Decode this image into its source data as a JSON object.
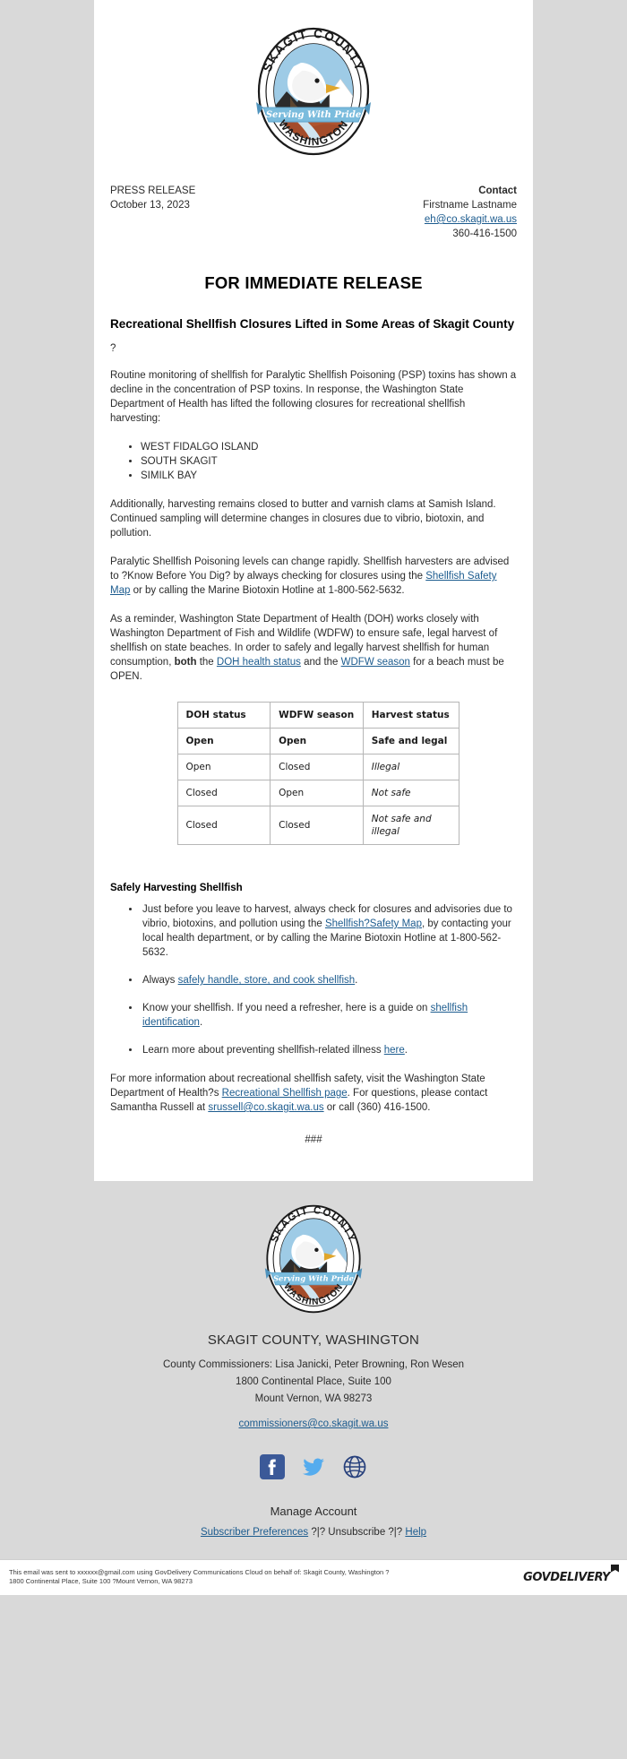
{
  "colors": {
    "link": "#1d5c8f",
    "page_bg": "#d9d9d9",
    "facebook": "#3b5998",
    "twitter": "#55acee",
    "globe": "#27407c"
  },
  "logo": {
    "alt": "Skagit County Washington seal",
    "top_text": "SKAGIT COUNTY",
    "bottom_text": "WASHINGTON",
    "ribbon_text": "Serving With Pride"
  },
  "header": {
    "kicker": "PRESS RELEASE",
    "date": "October 13, 2023",
    "contact_label": "Contact",
    "contact_name": "Firstname Lastname",
    "contact_email": "eh@co.skagit.wa.us",
    "contact_phone": "360-416-1500"
  },
  "release": {
    "headline": "FOR IMMEDIATE RELEASE",
    "subject": "Recreational Shellfish Closures Lifted in Some Areas of Skagit County",
    "stray_char": "?",
    "para_1": "Routine monitoring of shellfish for Paralytic Shellfish Poisoning (PSP) toxins has shown a decline in the concentration of PSP toxins. In response, the Washington State Department of Health has lifted the following closures for recreational shellfish harvesting:",
    "closures": [
      "WEST FIDALGO ISLAND",
      "SOUTH SKAGIT",
      "SIMILK BAY"
    ],
    "para_2": "Additionally, harvesting remains closed to butter and varnish clams at Samish Island. Continued sampling will determine changes in closures due to vibrio, biotoxin, and pollution.",
    "para_3_a": "Paralytic Shellfish Poisoning levels can change rapidly. Shellfish harvesters are advised to ?Know Before You Dig? by always checking for closures using the ",
    "para_3_link": "Shellfish Safety Map",
    "para_3_b": " or by calling the Marine Biotoxin Hotline at 1-800-562-5632.",
    "para_4_a": "As a reminder, Washington State Department of Health (DOH) works closely with Washington Department of Fish and Wildlife (WDFW) to ensure safe, legal harvest of shellfish on state beaches. In order to safely and legally harvest shellfish for human consumption, ",
    "para_4_bold": "both",
    "para_4_b": " the ",
    "para_4_link1": "DOH health status",
    "para_4_c": " and the ",
    "para_4_link2": "WDFW season",
    "para_4_d": " for a beach must be OPEN."
  },
  "status_table": {
    "headers": [
      "DOH status",
      "WDFW season",
      "Harvest status"
    ],
    "rows": [
      {
        "doh": "Open",
        "wdfw": "Open",
        "harvest": "Safe and legal",
        "bold": true,
        "italic": false
      },
      {
        "doh": "Open",
        "wdfw": "Closed",
        "harvest": "Illegal",
        "bold": false,
        "italic": true
      },
      {
        "doh": "Closed",
        "wdfw": "Open",
        "harvest": "Not safe",
        "bold": false,
        "italic": true
      },
      {
        "doh": "Closed",
        "wdfw": "Closed",
        "harvest": "Not safe and illegal",
        "bold": false,
        "italic": true
      }
    ]
  },
  "safely": {
    "heading": "Safely Harvesting Shellfish",
    "b1_a": "Just before you leave to harvest, always check for closures and advisories due to vibrio, biotoxins, and pollution using the ",
    "b1_link": "Shellfish?Safety Map",
    "b1_b": ", by contacting your local health department, or by calling the Marine Biotoxin Hotline at 1-800-562-5632.",
    "b2_a": "Always ",
    "b2_link": "safely handle, store, and cook shellfish",
    "b2_b": ".",
    "b3_a": "Know your shellfish. If you need a refresher, here is a guide on ",
    "b3_link": "shellfish identification",
    "b3_b": ".",
    "b4_a": "Learn more about preventing shellfish-related illness ",
    "b4_link": "here",
    "b4_b": "."
  },
  "closing": {
    "a": "For more information about recreational shellfish safety, visit the Washington State Department of Health?s ",
    "link1": "Recreational Shellfish page",
    "b": ". For questions, please contact Samantha Russell at ",
    "link2": "srussell@co.skagit.wa.us",
    "c": " or call (360) 416-1500.",
    "end_mark": "###"
  },
  "footer": {
    "org": "SKAGIT COUNTY, WASHINGTON",
    "commissioners": "County Commissioners: Lisa Janicki, Peter Browning, Ron Wesen",
    "address_1": "1800 Continental Place, Suite 100",
    "address_2": "Mount Vernon, WA 98273",
    "email": "commissioners@co.skagit.wa.us",
    "socials": [
      {
        "name": "facebook-icon",
        "label": "Facebook"
      },
      {
        "name": "twitter-icon",
        "label": "Twitter"
      },
      {
        "name": "website-globe-icon",
        "label": "Website"
      }
    ],
    "manage_heading": "Manage Account",
    "link_preferences": "Subscriber Preferences",
    "sep_1": " ?|? ",
    "link_unsubscribe": "Unsubscribe",
    "sep_2": " ?|? ",
    "link_help": "Help"
  },
  "legal": {
    "line_1": "This email was sent to xxxxxx@gmail.com using GovDelivery Communications Cloud on behalf of: Skagit County, Washington ?",
    "line_2": "1800 Continental Place, Suite 100 ?Mount Vernon, WA 98273",
    "brand": "GOVDELIVERY"
  }
}
